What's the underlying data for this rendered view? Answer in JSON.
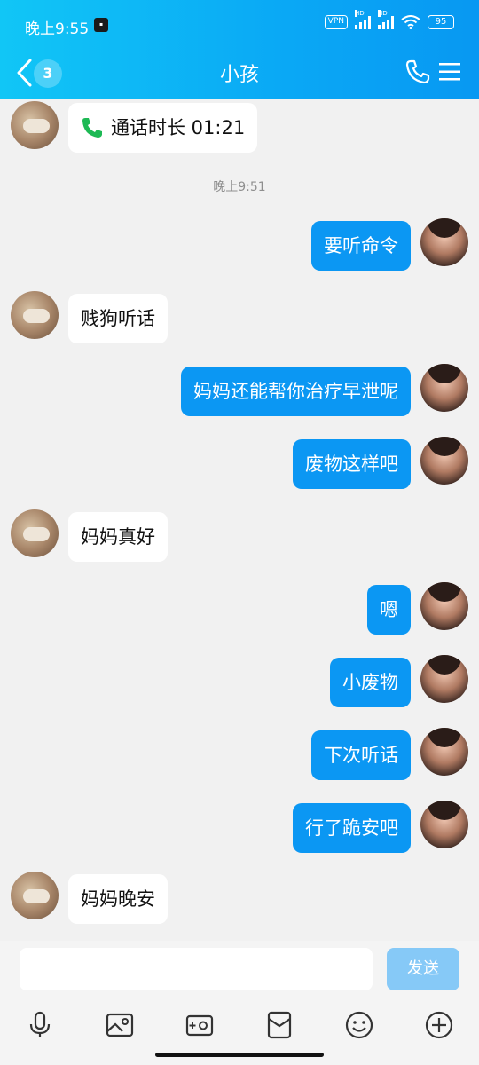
{
  "status_bar": {
    "time": "晚上9:55",
    "vpn": "VPN",
    "hd1": "HD",
    "hd2": "HD",
    "battery": "95"
  },
  "header": {
    "unread_count": "3",
    "title": "小孩"
  },
  "messages": [
    {
      "side": "left",
      "type": "call",
      "text": "通话时长 01:21"
    },
    {
      "type": "timestamp",
      "text": "晚上9:51"
    },
    {
      "side": "right",
      "text": "要听命令"
    },
    {
      "side": "left",
      "text": "贱狗听话"
    },
    {
      "side": "right",
      "text": "妈妈还能帮你治疗早泄呢"
    },
    {
      "side": "right",
      "text": "废物这样吧"
    },
    {
      "side": "left",
      "text": "妈妈真好"
    },
    {
      "side": "right",
      "text": "嗯"
    },
    {
      "side": "right",
      "text": "小废物"
    },
    {
      "side": "right",
      "text": "下次听话"
    },
    {
      "side": "right",
      "text": "行了跪安吧"
    },
    {
      "side": "left",
      "text": "妈妈晚安"
    }
  ],
  "input": {
    "value": "",
    "send_label": "发送"
  },
  "colors": {
    "header_start": "#11c6f6",
    "header_end": "#0898f2",
    "bubble_self": "#0b97f3",
    "bubble_other": "#ffffff",
    "call_icon": "#1db954",
    "send_disabled": "#86c9f7"
  }
}
